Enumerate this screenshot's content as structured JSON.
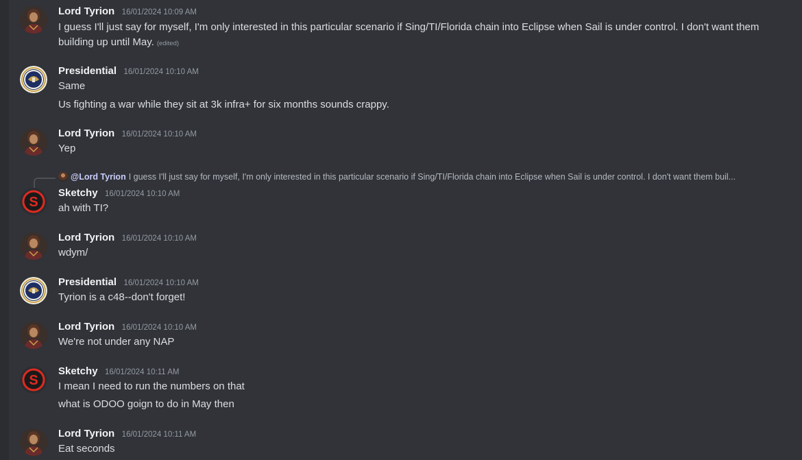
{
  "messages": [
    {
      "author": "Lord Tyrion",
      "timestamp": "16/01/2024 10:09 AM",
      "avatar": "tyrion-avatar",
      "lines": [
        "I guess I'll just say for myself, I'm only interested in this particular scenario if Sing/TI/Florida chain into Eclipse when Sail is under control. I don't want them building up until May."
      ],
      "edited_label": "(edited)"
    },
    {
      "author": "Presidential",
      "timestamp": "16/01/2024 10:10 AM",
      "avatar": "presidential-seal-avatar",
      "lines": [
        "Same",
        "Us fighting a war while they sit at 3k infra+ for six months sounds crappy."
      ]
    },
    {
      "author": "Lord Tyrion",
      "timestamp": "16/01/2024 10:10 AM",
      "avatar": "tyrion-avatar",
      "lines": [
        "Yep"
      ]
    },
    {
      "author": "Sketchy",
      "timestamp": "16/01/2024 10:10 AM",
      "avatar": "sketchy-s-avatar",
      "reply": {
        "mention": "@Lord Tyrion",
        "preview": "I guess I'll just say for myself, I'm only interested in this particular scenario if Sing/TI/Florida chain into Eclipse when Sail is under control. I don't want them buil..."
      },
      "lines": [
        "ah with TI?"
      ]
    },
    {
      "author": "Lord Tyrion",
      "timestamp": "16/01/2024 10:10 AM",
      "avatar": "tyrion-avatar",
      "lines": [
        "wdym/"
      ]
    },
    {
      "author": "Presidential",
      "timestamp": "16/01/2024 10:10 AM",
      "avatar": "presidential-seal-avatar",
      "lines": [
        "Tyrion is a c48--don't forget!"
      ]
    },
    {
      "author": "Lord Tyrion",
      "timestamp": "16/01/2024 10:10 AM",
      "avatar": "tyrion-avatar",
      "lines": [
        "We're not under any NAP"
      ]
    },
    {
      "author": "Sketchy",
      "timestamp": "16/01/2024 10:11 AM",
      "avatar": "sketchy-s-avatar",
      "lines": [
        "I mean I need to run the numbers on that",
        "what is ODOO goign to do in May then"
      ]
    },
    {
      "author": "Lord Tyrion",
      "timestamp": "16/01/2024 10:11 AM",
      "avatar": "tyrion-avatar",
      "lines": [
        "Eat seconds"
      ]
    }
  ],
  "colors": {
    "background": "#313338",
    "author": "#f2f3f5",
    "text": "#dbdee1",
    "timestamp": "#949ba4",
    "mention": "#c9cdfb",
    "sketchy_ring": "#e02a20"
  },
  "icons": {
    "sketchy_letter": "S"
  }
}
